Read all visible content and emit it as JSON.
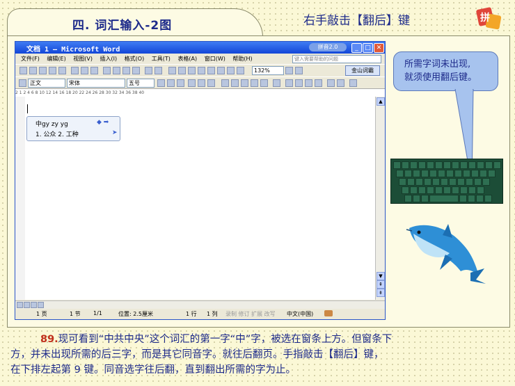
{
  "slide": {
    "title": "四. 词汇输入-2图",
    "subtitle": "右手敲击【翻后】键",
    "logo_text": "拼音"
  },
  "word_window": {
    "title": "文档 1 — Microsoft Word",
    "search_pill": "拼音2.0",
    "menu": [
      "文件(F)",
      "编辑(E)",
      "视图(V)",
      "插入(I)",
      "格式(O)",
      "工具(T)",
      "表格(A)",
      "窗口(W)",
      "帮助(H)"
    ],
    "ask_placeholder": "键入需要帮助的问题",
    "toolbar": {
      "zoom": "132%",
      "jinshan_button": "金山词霸"
    },
    "format_bar": {
      "style": "正文",
      "font": "宋体",
      "size": "五号"
    },
    "ruler_text": "2  1  2  4  6  8  10  12  14  16  18  20  22  24  26  28  30  32  34  36  38  40",
    "ime": {
      "pinyin": "中gy zy yg",
      "candidates": "1. 公众   2. 工种",
      "arrows": "◆ ➡",
      "next": "➤"
    },
    "status": {
      "page": "1 页",
      "section": "1 节",
      "page_of": "1/1",
      "position": "位置: 2.5厘米",
      "line": "1 行",
      "column": "1 列",
      "flags": "录制 修订 扩展 改写",
      "language": "中文(中国)"
    }
  },
  "callout": {
    "line1": "所需字词未出现,",
    "line2": "就须使用翻后键。"
  },
  "caption": {
    "number": "89.",
    "line1": "现可看到“中共中央”这个词汇的第一字“中”字，被选在窗条上方。但窗条下",
    "line2": "方，并未出现所需的后三字，而是其它同音字。就往后翻页。手指敲击【翻后】键，",
    "line3": "在下排左起第 9 键。同音选字往后翻，直到翻出所需的字为止。"
  },
  "colors": {
    "text_blue": "#1d2a8a",
    "number_red": "#c0301c",
    "callout_blue": "#a7c3ee",
    "keyboard_green": "#1c4d37"
  }
}
